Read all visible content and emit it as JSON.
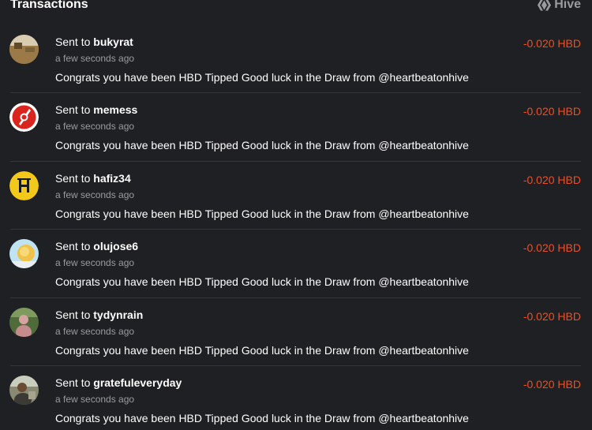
{
  "header": {
    "title": "Transactions",
    "brand_label": "Hive",
    "brand_icon": "hive-logo-icon"
  },
  "colors": {
    "background": "#1f2023",
    "amount": "#e8512a",
    "muted": "#9a9ba0"
  },
  "transactions": [
    {
      "prefix": "Sent to",
      "user": "bukyrat",
      "time": "a few seconds ago",
      "memo": "Congrats you have been HBD Tipped Good luck in the Draw from @heartbeatonhive",
      "amount": "-0.020 HBD",
      "avatar": "avatar-landscape-icon"
    },
    {
      "prefix": "Sent to",
      "user": "memess",
      "time": "a few seconds ago",
      "memo": "Congrats you have been HBD Tipped Good luck in the Draw from @heartbeatonhive",
      "amount": "-0.020 HBD",
      "avatar": "avatar-red-logo-icon"
    },
    {
      "prefix": "Sent to",
      "user": "hafiz34",
      "time": "a few seconds ago",
      "memo": "Congrats you have been HBD Tipped Good luck in the Draw from @heartbeatonhive",
      "amount": "-0.020 HBD",
      "avatar": "avatar-yellow-h-icon"
    },
    {
      "prefix": "Sent to",
      "user": "olujose6",
      "time": "a few seconds ago",
      "memo": "Congrats you have been HBD Tipped Good luck in the Draw from @heartbeatonhive",
      "amount": "-0.020 HBD",
      "avatar": "avatar-sky-icon"
    },
    {
      "prefix": "Sent to",
      "user": "tydynrain",
      "time": "a few seconds ago",
      "memo": "Congrats you have been HBD Tipped Good luck in the Draw from @heartbeatonhive",
      "amount": "-0.020 HBD",
      "avatar": "avatar-person-green-icon"
    },
    {
      "prefix": "Sent to",
      "user": "gratefuleveryday",
      "time": "a few seconds ago",
      "memo": "Congrats you have been HBD Tipped Good luck in the Draw from @heartbeatonhive",
      "amount": "-0.020 HBD",
      "avatar": "avatar-person-outdoor-icon"
    }
  ]
}
